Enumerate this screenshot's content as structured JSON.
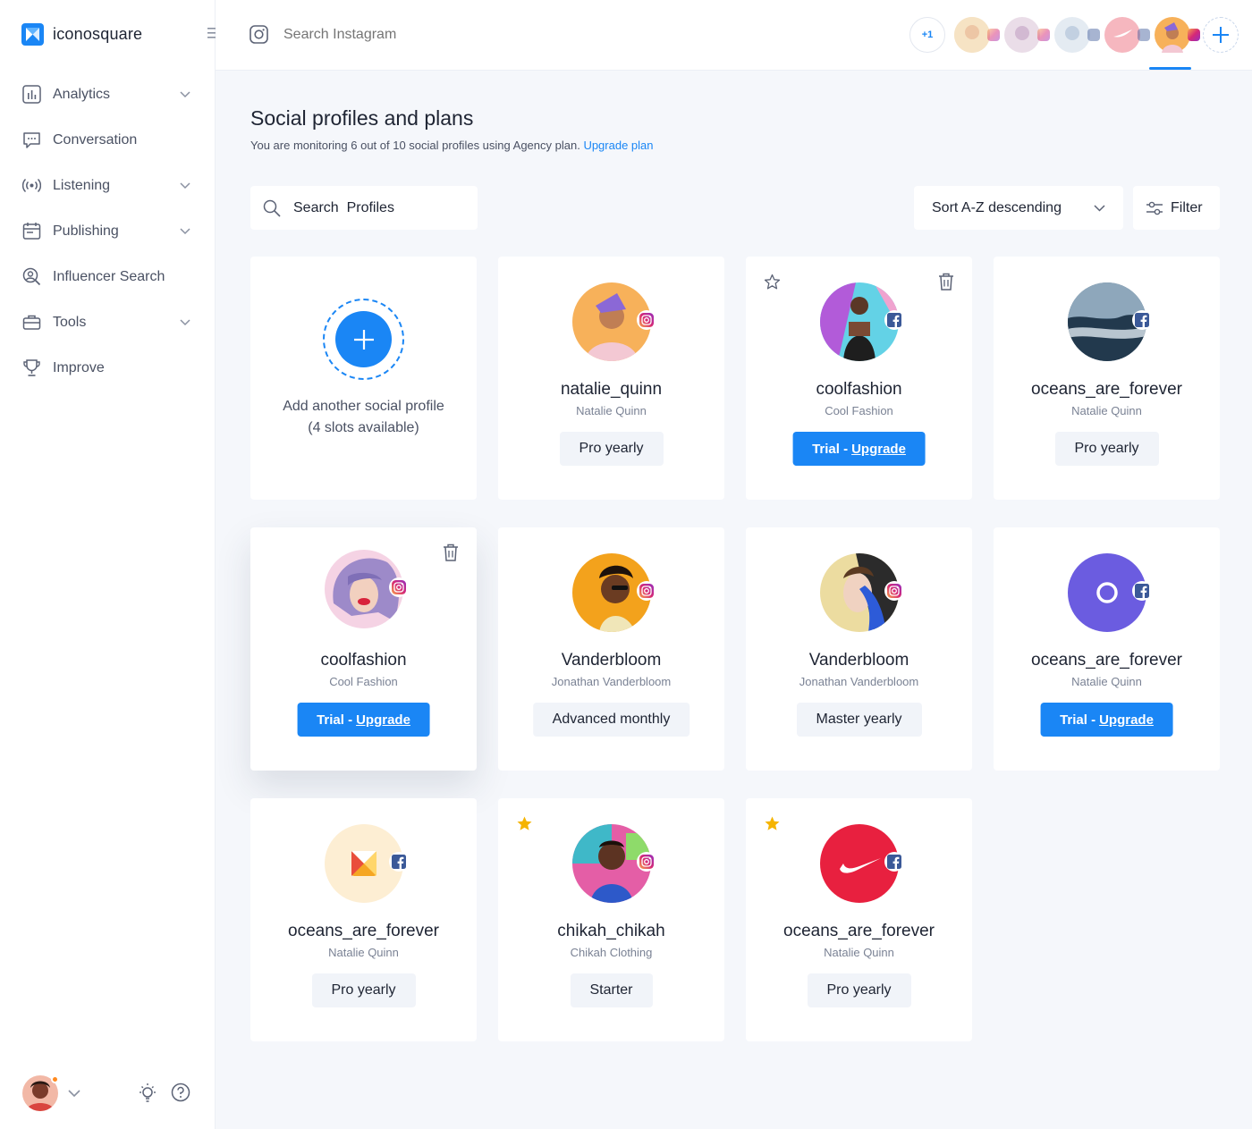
{
  "app": {
    "name": "iconosquare"
  },
  "sidebar": {
    "items": [
      {
        "label": "Analytics",
        "icon": "analytics-icon",
        "expandable": true
      },
      {
        "label": "Conversation",
        "icon": "conversation-icon",
        "expandable": false
      },
      {
        "label": "Listening",
        "icon": "listening-icon",
        "expandable": true
      },
      {
        "label": "Publishing",
        "icon": "publishing-icon",
        "expandable": true
      },
      {
        "label": "Influencer Search",
        "icon": "influencer-search-icon",
        "expandable": false
      },
      {
        "label": "Tools",
        "icon": "tools-icon",
        "expandable": true
      },
      {
        "label": "Improve",
        "icon": "trophy-icon",
        "expandable": false
      }
    ]
  },
  "topbar": {
    "search_placeholder": "Search Instagram",
    "more_count": "+1"
  },
  "page": {
    "title": "Social profiles and plans",
    "subtitle": "You are monitoring 6 out of 10 social profiles using Agency plan.",
    "upgrade_link": "Upgrade plan",
    "search_placeholder": "Search  Profiles",
    "sort_label": "Sort A-Z descending",
    "filter_label": "Filter"
  },
  "add_card": {
    "line1": "Add another social profile",
    "line2": "(4 slots available)"
  },
  "profiles": [
    {
      "username": "natalie_quinn",
      "name": "Natalie Quinn",
      "plan": "Pro yearly",
      "network": "instagram",
      "trial": false
    },
    {
      "username": "coolfashion",
      "name": "Cool Fashion",
      "plan": "Trial -",
      "upgrade": "Upgrade",
      "network": "facebook",
      "trial": true
    },
    {
      "username": "oceans_are_forever",
      "name": "Natalie Quinn",
      "plan": "Pro yearly",
      "network": "facebook",
      "trial": false
    },
    {
      "username": "coolfashion",
      "name": "Cool Fashion",
      "plan": "Trial -",
      "upgrade": "Upgrade",
      "network": "instagram",
      "trial": true
    },
    {
      "username": "Vanderbloom",
      "name": "Jonathan Vanderbloom",
      "plan": "Advanced monthly",
      "network": "instagram",
      "trial": false
    },
    {
      "username": "Vanderbloom",
      "name": "Jonathan Vanderbloom",
      "plan": "Master yearly",
      "network": "instagram",
      "trial": false
    },
    {
      "username": "oceans_are_forever",
      "name": "Natalie Quinn",
      "plan": "Trial -",
      "upgrade": "Upgrade",
      "network": "facebook",
      "trial": true
    },
    {
      "username": "oceans_are_forever",
      "name": "Natalie Quinn",
      "plan": "Pro yearly",
      "network": "facebook",
      "trial": false
    },
    {
      "username": "chikah_chikah",
      "name": "Chikah Clothing",
      "plan": "Starter",
      "network": "instagram",
      "trial": false
    },
    {
      "username": "oceans_are_forever",
      "name": "Natalie Quinn",
      "plan": "Pro yearly",
      "network": "facebook",
      "trial": false
    }
  ],
  "colors": {
    "accent": "#1a86f5",
    "star": "#f5b400",
    "background": "#f5f7fb"
  }
}
